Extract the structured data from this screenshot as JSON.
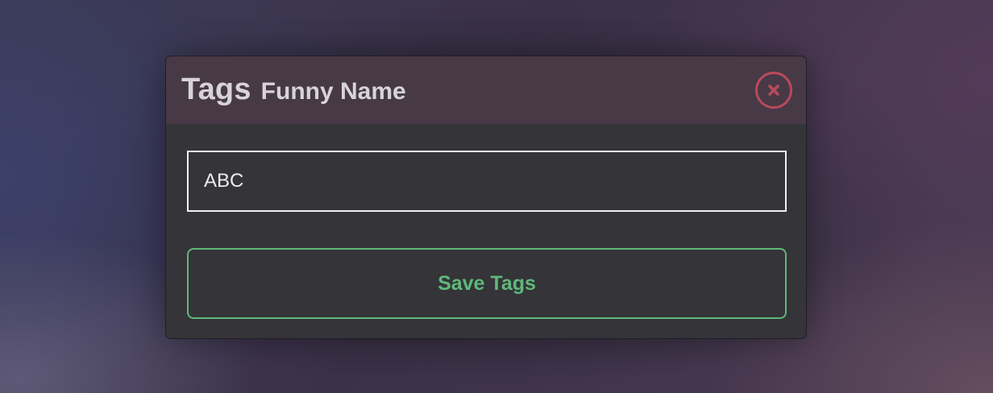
{
  "dialog": {
    "title": "Tags",
    "subtitle": "Funny Name",
    "close_icon": "close-circle-icon",
    "input_value": "ABC",
    "save_label": "Save Tags"
  },
  "colors": {
    "header_bg": "#473945",
    "body_bg": "#343439",
    "close_red": "#b84a5a",
    "accent_green": "#5fb879",
    "input_border": "#f2f2f2"
  }
}
